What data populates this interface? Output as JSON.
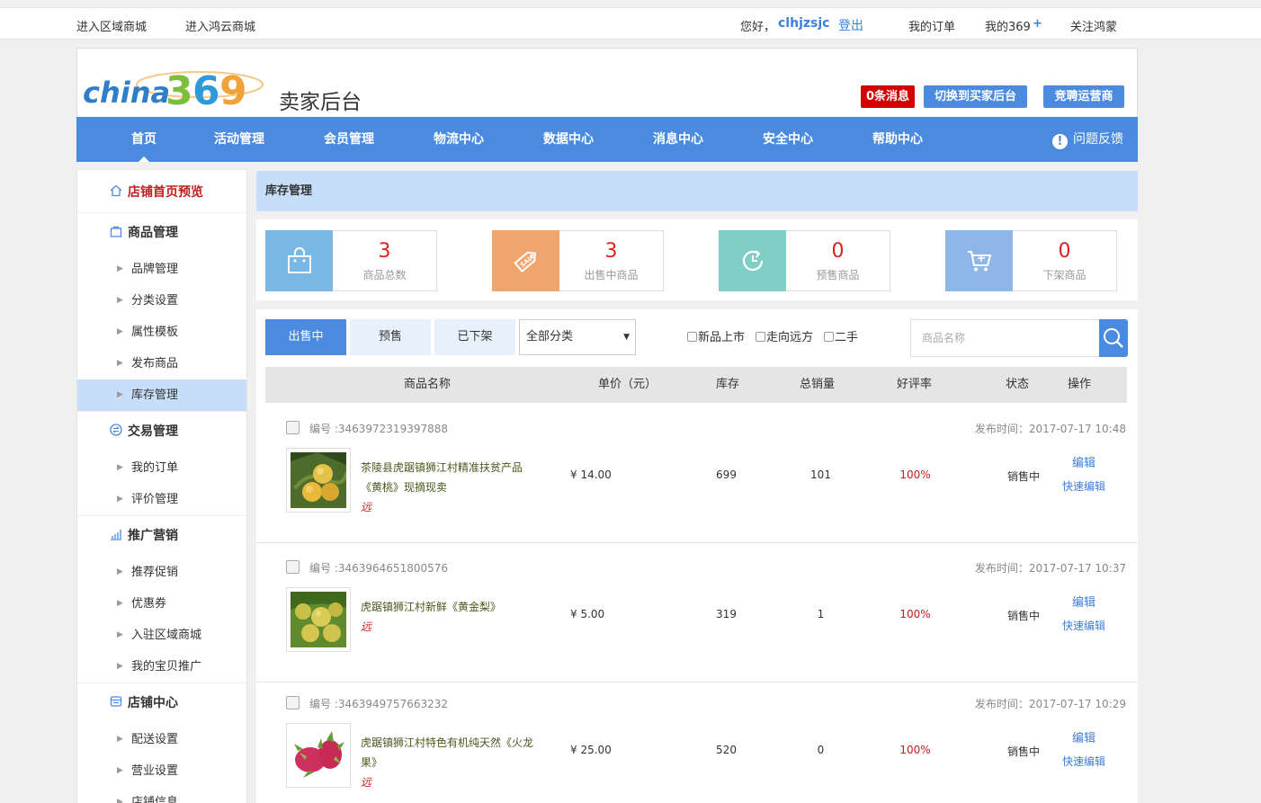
{
  "topbar": {
    "region_mall": "进入区域商城",
    "hongyun_mall": "进入鸿云商城",
    "greeting": "您好，",
    "username": "clhjzsjc",
    "logout": "登出",
    "my_orders": "我的订单",
    "my369": "我的369",
    "plus": "+",
    "follow": "关注鸿蒙"
  },
  "header": {
    "logo_text": "china369",
    "title": "卖家后台",
    "messages": "0条消息",
    "switch_buyer": "切换到买家后台",
    "compete": "竞聘运营商"
  },
  "nav": {
    "items": [
      "首页",
      "活动管理",
      "会员管理",
      "物流中心",
      "数据中心",
      "消息中心",
      "安全中心",
      "帮助中心"
    ],
    "feedback": "问题反馈"
  },
  "sidebar": {
    "store_preview": "店铺首页预览",
    "goods_mgmt": "商品管理",
    "goods_items": [
      "品牌管理",
      "分类设置",
      "属性模板",
      "发布商品",
      "库存管理"
    ],
    "trade_mgmt": "交易管理",
    "trade_items": [
      "我的订单",
      "评价管理"
    ],
    "promo": "推广营销",
    "promo_items": [
      "推荐促销",
      "优惠券",
      "入驻区域商城",
      "我的宝贝推广"
    ],
    "store_center": "店铺中心",
    "store_items": [
      "配送设置",
      "营业设置",
      "店铺信息"
    ]
  },
  "content": {
    "title": "库存管理",
    "stats": [
      {
        "value": "3",
        "label": "商品总数",
        "color": "#7ab8e6"
      },
      {
        "value": "3",
        "label": "出售中商品",
        "color": "#f0a56f"
      },
      {
        "value": "0",
        "label": "预售商品",
        "color": "#7fcfc6"
      },
      {
        "value": "0",
        "label": "下架商品",
        "color": "#8fb6e8"
      }
    ],
    "tabs": [
      "出售中",
      "预售",
      "已下架"
    ],
    "category_select": "全部分类",
    "checkboxes": [
      "新品上市",
      "走向远方",
      "二手"
    ],
    "search_placeholder": "商品名称",
    "columns": [
      "商品名称",
      "单价（元）",
      "库存",
      "总销量",
      "好评率",
      "状态",
      "操作"
    ],
    "rows": [
      {
        "code": "编号 :3463972319397888",
        "date": "发布时间：2017-07-17 10:48",
        "name": "茶陵县虎踞镇狮江村精准扶贫产品《黄桃》现摘现卖",
        "tag": "远",
        "price": "¥ 14.00",
        "stock": "699",
        "sales": "101",
        "rate": "100%",
        "status": "销售中",
        "edit": "编辑",
        "quick_edit": "快速编辑"
      },
      {
        "code": "编号 :3463964651800576",
        "date": "发布时间：2017-07-17 10:37",
        "name": "虎踞镇狮江村新鲜《黄金梨》",
        "tag": "远",
        "price": "¥ 5.00",
        "stock": "319",
        "sales": "1",
        "rate": "100%",
        "status": "销售中",
        "edit": "编辑",
        "quick_edit": "快速编辑"
      },
      {
        "code": "编号 :3463949757663232",
        "date": "发布时间：2017-07-17 10:29",
        "name": "虎踞镇狮江村特色有机纯天然《火龙果》",
        "tag": "远",
        "price": "¥ 25.00",
        "stock": "520",
        "sales": "0",
        "rate": "100%",
        "status": "销售中",
        "edit": "编辑",
        "quick_edit": "快速编辑"
      }
    ]
  }
}
